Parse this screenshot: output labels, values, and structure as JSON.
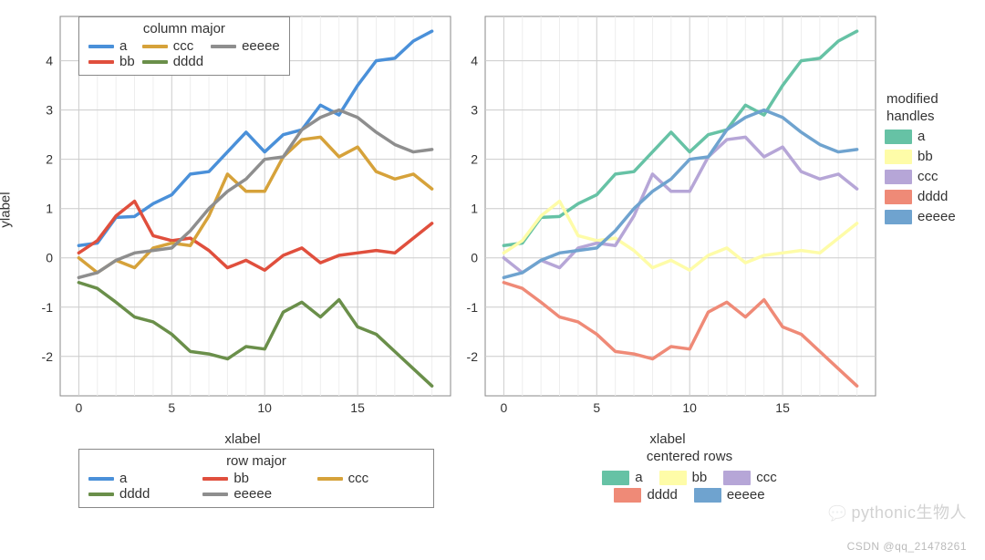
{
  "palette_left": {
    "a": "#4a90d9",
    "bb": "#e04f3d",
    "ccc": "#d6a23a",
    "dddd": "#6a8f4a",
    "eeeee": "#8e8e8e"
  },
  "palette_right": {
    "a": "#66c2a5",
    "bb": "#fefca8",
    "ccc": "#b6a6d7",
    "dddd": "#ef8a77",
    "eeeee": "#6fa3cf"
  },
  "chart_data": [
    {
      "type": "line",
      "xlabel": "xlabel",
      "ylabel": "ylabel",
      "xlim": [
        -1,
        20
      ],
      "ylim": [
        -2.8,
        4.9
      ],
      "xticks": [
        0,
        5,
        10,
        15
      ],
      "yticks": [
        -2,
        -1,
        0,
        1,
        2,
        3,
        4
      ],
      "x": [
        0,
        1,
        2,
        3,
        4,
        5,
        6,
        7,
        8,
        9,
        10,
        11,
        12,
        13,
        14,
        15,
        16,
        17,
        18,
        19
      ],
      "series": [
        {
          "name": "a",
          "values": [
            0.25,
            0.3,
            0.82,
            0.84,
            1.1,
            1.28,
            1.7,
            1.75,
            2.15,
            2.55,
            2.15,
            2.5,
            2.6,
            3.1,
            2.9,
            3.5,
            4.0,
            4.05,
            4.4,
            4.6
          ]
        },
        {
          "name": "bb",
          "values": [
            0.1,
            0.35,
            0.85,
            1.15,
            0.45,
            0.35,
            0.4,
            0.15,
            -0.2,
            -0.05,
            -0.25,
            0.05,
            0.2,
            -0.1,
            0.05,
            0.1,
            0.15,
            0.1,
            0.4,
            0.7
          ]
        },
        {
          "name": "ccc",
          "values": [
            0.0,
            -0.3,
            -0.05,
            -0.2,
            0.2,
            0.3,
            0.25,
            0.85,
            1.7,
            1.35,
            1.35,
            2.05,
            2.4,
            2.45,
            2.05,
            2.25,
            1.75,
            1.6,
            1.7,
            1.4
          ]
        },
        {
          "name": "dddd",
          "values": [
            -0.5,
            -0.62,
            -0.9,
            -1.2,
            -1.3,
            -1.55,
            -1.9,
            -1.95,
            -2.05,
            -1.8,
            -1.85,
            -1.1,
            -0.9,
            -1.2,
            -0.85,
            -1.4,
            -1.55,
            -1.9,
            -2.25,
            -2.6
          ]
        },
        {
          "name": "eeeee",
          "values": [
            -0.4,
            -0.3,
            -0.05,
            0.1,
            0.15,
            0.2,
            0.55,
            1.0,
            1.35,
            1.6,
            2.0,
            2.05,
            2.6,
            2.85,
            3.0,
            2.85,
            2.55,
            2.3,
            2.15,
            2.2
          ]
        }
      ]
    },
    {
      "type": "line",
      "xlabel": "xlabel",
      "ylabel": "",
      "xlim": [
        -1,
        20
      ],
      "ylim": [
        -2.8,
        4.9
      ],
      "xticks": [
        0,
        5,
        10,
        15
      ],
      "yticks": [
        -2,
        -1,
        0,
        1,
        2,
        3,
        4
      ],
      "x": [
        0,
        1,
        2,
        3,
        4,
        5,
        6,
        7,
        8,
        9,
        10,
        11,
        12,
        13,
        14,
        15,
        16,
        17,
        18,
        19
      ],
      "series": [
        {
          "name": "a",
          "values": [
            0.25,
            0.3,
            0.82,
            0.84,
            1.1,
            1.28,
            1.7,
            1.75,
            2.15,
            2.55,
            2.15,
            2.5,
            2.6,
            3.1,
            2.9,
            3.5,
            4.0,
            4.05,
            4.4,
            4.6
          ]
        },
        {
          "name": "bb",
          "values": [
            0.1,
            0.35,
            0.85,
            1.15,
            0.45,
            0.35,
            0.4,
            0.15,
            -0.2,
            -0.05,
            -0.25,
            0.05,
            0.2,
            -0.1,
            0.05,
            0.1,
            0.15,
            0.1,
            0.4,
            0.7
          ]
        },
        {
          "name": "ccc",
          "values": [
            0.0,
            -0.3,
            -0.05,
            -0.2,
            0.2,
            0.3,
            0.25,
            0.85,
            1.7,
            1.35,
            1.35,
            2.05,
            2.4,
            2.45,
            2.05,
            2.25,
            1.75,
            1.6,
            1.7,
            1.4
          ]
        },
        {
          "name": "dddd",
          "values": [
            -0.5,
            -0.62,
            -0.9,
            -1.2,
            -1.3,
            -1.55,
            -1.9,
            -1.95,
            -2.05,
            -1.8,
            -1.85,
            -1.1,
            -0.9,
            -1.2,
            -0.85,
            -1.4,
            -1.55,
            -1.9,
            -2.25,
            -2.6
          ]
        },
        {
          "name": "eeeee",
          "values": [
            -0.4,
            -0.3,
            -0.05,
            0.1,
            0.15,
            0.2,
            0.55,
            1.0,
            1.35,
            1.6,
            2.0,
            2.05,
            2.6,
            2.85,
            3.0,
            2.85,
            2.55,
            2.3,
            2.15,
            2.2
          ]
        }
      ]
    }
  ],
  "legends": {
    "col_major": {
      "title": "column major",
      "order": [
        "a",
        "bb",
        "ccc",
        "dddd",
        "eeeee"
      ]
    },
    "row_major": {
      "title": "row major",
      "order": [
        "a",
        "bb",
        "ccc",
        "dddd",
        "eeeee"
      ]
    },
    "modified": {
      "title1": "modified",
      "title2": "handles",
      "order": [
        "a",
        "bb",
        "ccc",
        "dddd",
        "eeeee"
      ]
    },
    "centered": {
      "title": "centered rows",
      "rows": [
        [
          "a",
          "bb",
          "ccc"
        ],
        [
          "dddd",
          "eeeee"
        ]
      ]
    }
  },
  "watermark": {
    "brand": "pythonic生物人",
    "credit": "CSDN @qq_21478261"
  }
}
